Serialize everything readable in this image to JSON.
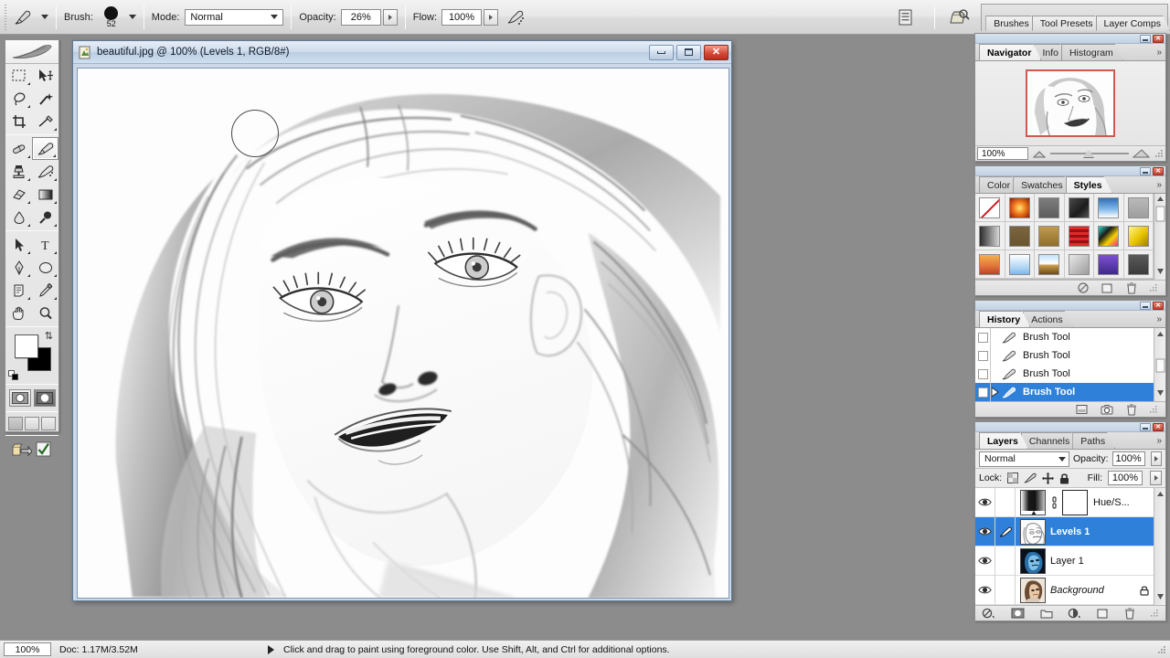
{
  "app": {
    "name": "Adobe Photoshop"
  },
  "options_bar": {
    "tool_icon": "brush-tool-icon",
    "brush_label": "Brush:",
    "brush_size": "52",
    "mode_label": "Mode:",
    "mode_value": "Normal",
    "opacity_label": "Opacity:",
    "opacity_value": "26%",
    "flow_label": "Flow:",
    "flow_value": "100%",
    "airbrush_icon": "airbrush-icon",
    "toggle_palettes_icon": "toggle-palettes-icon",
    "file_browser_icon": "file-browser-icon",
    "palette_well_tabs": [
      "Brushes",
      "Tool Presets",
      "Layer Comps"
    ]
  },
  "toolbox": {
    "header_icon": "photoshop-feather-logo",
    "tools": [
      {
        "name": "marquee-tool",
        "glyph": "marquee",
        "selected": false,
        "corner": true
      },
      {
        "name": "move-tool",
        "glyph": "move",
        "selected": false,
        "corner": false
      },
      {
        "name": "lasso-tool",
        "glyph": "lasso",
        "selected": false,
        "corner": true
      },
      {
        "name": "magic-wand-tool",
        "glyph": "wand",
        "selected": false,
        "corner": false
      },
      {
        "name": "crop-tool",
        "glyph": "crop",
        "selected": false,
        "corner": false
      },
      {
        "name": "slice-tool",
        "glyph": "slice",
        "selected": false,
        "corner": true
      },
      {
        "name": "healing-brush-tool",
        "glyph": "heal",
        "selected": false,
        "corner": true
      },
      {
        "name": "brush-tool",
        "glyph": "brush",
        "selected": true,
        "corner": true
      },
      {
        "name": "clone-stamp-tool",
        "glyph": "stamp",
        "selected": false,
        "corner": true
      },
      {
        "name": "history-brush-tool",
        "glyph": "historybrush",
        "selected": false,
        "corner": true
      },
      {
        "name": "eraser-tool",
        "glyph": "eraser",
        "selected": false,
        "corner": true
      },
      {
        "name": "gradient-tool",
        "glyph": "gradient",
        "selected": false,
        "corner": true
      },
      {
        "name": "blur-tool",
        "glyph": "blur",
        "selected": false,
        "corner": true
      },
      {
        "name": "dodge-tool",
        "glyph": "dodge",
        "selected": false,
        "corner": true
      },
      {
        "name": "path-selection-tool",
        "glyph": "pathsel",
        "selected": false,
        "corner": true
      },
      {
        "name": "type-tool",
        "glyph": "type",
        "selected": false,
        "corner": true
      },
      {
        "name": "pen-tool",
        "glyph": "pen",
        "selected": false,
        "corner": true
      },
      {
        "name": "shape-tool",
        "glyph": "shape",
        "selected": false,
        "corner": true
      },
      {
        "name": "notes-tool",
        "glyph": "notes",
        "selected": false,
        "corner": true
      },
      {
        "name": "eyedropper-tool",
        "glyph": "eyedropper",
        "selected": false,
        "corner": true
      },
      {
        "name": "hand-tool",
        "glyph": "hand",
        "selected": false,
        "corner": false
      },
      {
        "name": "zoom-tool",
        "glyph": "zoom",
        "selected": false,
        "corner": false
      }
    ],
    "foreground_color": "#ffffff",
    "background_color": "#000000",
    "quickmask_modes": [
      "standard-mask-mode",
      "quick-mask-mode"
    ],
    "screen_modes": [
      "standard-screen-mode",
      "full-screen-with-menubar",
      "full-screen-mode"
    ],
    "jump_to_imageready_icon": "jump-to-imageready-icon",
    "check_icon": "check-icon"
  },
  "document": {
    "title": "beautiful.jpg @ 100% (Levels 1, RGB/8#)",
    "icon": "document-icon",
    "window_buttons": [
      "minimize",
      "maximize",
      "close"
    ],
    "canvas_description": "pencil-sketch portrait of a woman looking upward",
    "brush_cursor_size_px": 52
  },
  "navigator_panel": {
    "tabs": [
      "Navigator",
      "Info",
      "Histogram"
    ],
    "active_tab": "Navigator",
    "more_icon": "panel-menu-icon",
    "zoom_value": "100%",
    "zoom_out_icon": "zoom-out-icon",
    "zoom_in_icon": "zoom-in-icon",
    "view_box_color": "#cc5a4e"
  },
  "styles_panel": {
    "tabs": [
      "Color",
      "Swatches",
      "Styles"
    ],
    "active_tab": "Styles",
    "more_icon": "panel-menu-icon",
    "swatches": [
      {
        "name": "none-style",
        "type": "none"
      },
      {
        "name": "style-red-glow",
        "css": "radial-gradient(circle at 50% 50%, #ffe47a 0%, #ef7a1b 45%, #8c1a05 100%)"
      },
      {
        "name": "style-gray-button",
        "css": "linear-gradient(to bottom,#7d7d7d,#5d5d5d)"
      },
      {
        "name": "style-dark-texture",
        "css": "linear-gradient(135deg,#4a4a4a,#1c1c1c 60%,#555)"
      },
      {
        "name": "style-blue-sky",
        "css": "linear-gradient(to bottom,#2f6fb5 0%,#7fb6e8 55%,#ffffff 100%)"
      },
      {
        "name": "style-flat-gray",
        "css": "linear-gradient(to bottom,#b9b9b9,#9e9e9e)"
      },
      {
        "name": "style-black-fade",
        "css": "linear-gradient(to right,#2b2b2b,#d6d6d6)"
      },
      {
        "name": "style-brown-matte",
        "css": "linear-gradient(to bottom,#7b6540,#6a552f)"
      },
      {
        "name": "style-tan-bevel",
        "css": "linear-gradient(to bottom,#c09a4e,#8e6f2f)"
      },
      {
        "name": "style-red-stripes",
        "css": "repeating-linear-gradient(to bottom,#e02a2a 0 3px,#9a0f12 3px 6px)"
      },
      {
        "name": "style-graffiti",
        "css": "linear-gradient(135deg,#2bd9c6 0%,#1a1a1a 35%,#f4d400 65%,#e0348a 100%)"
      },
      {
        "name": "style-yellow-bevel",
        "css": "linear-gradient(135deg,#fff38a,#e8c400 55%,#9a8000)"
      },
      {
        "name": "style-orange-sunset",
        "css": "linear-gradient(to bottom,#f3b24c,#e2713a 60%,#b8442a)"
      },
      {
        "name": "style-light-blue",
        "css": "linear-gradient(to bottom,#ffffff,#a9d2f3 70%,#7fb6e8)"
      },
      {
        "name": "style-beach",
        "css": "linear-gradient(to bottom,#bfe2f7 0%,#ffffff 45%,#c79a4a 55%,#6b4a1e 100%)"
      },
      {
        "name": "style-photo-frame",
        "css": "linear-gradient(135deg,#e8e8e8,#9c9c9c)"
      },
      {
        "name": "style-purple-blocks",
        "css": "linear-gradient(to bottom,#7d4fd4,#3e2b86)"
      },
      {
        "name": "style-charcoal",
        "css": "linear-gradient(to bottom,#5a5a5a,#3b3b3b)"
      }
    ],
    "footer_icons": [
      "clear-style-icon",
      "new-style-icon",
      "delete-style-icon"
    ]
  },
  "history_panel": {
    "tabs": [
      "History",
      "Actions"
    ],
    "active_tab": "History",
    "more_icon": "panel-menu-icon",
    "items": [
      {
        "label": "Brush Tool",
        "icon": "brush-state-icon",
        "selected": false
      },
      {
        "label": "Brush Tool",
        "icon": "brush-state-icon",
        "selected": false
      },
      {
        "label": "Brush Tool",
        "icon": "brush-state-icon",
        "selected": false
      },
      {
        "label": "Brush Tool",
        "icon": "brush-state-icon",
        "selected": true
      }
    ],
    "footer_icons": [
      "new-document-from-state-icon",
      "new-snapshot-icon",
      "delete-state-icon"
    ]
  },
  "layers_panel": {
    "tabs": [
      "Layers",
      "Channels",
      "Paths"
    ],
    "active_tab": "Layers",
    "more_icon": "panel-menu-icon",
    "blend_mode": "Normal",
    "opacity_label": "Opacity:",
    "opacity_value": "100%",
    "lock_label": "Lock:",
    "lock_icons": [
      "lock-transparent-pixels-icon",
      "lock-image-pixels-icon",
      "lock-position-icon",
      "lock-all-icon"
    ],
    "fill_label": "Fill:",
    "fill_value": "100%",
    "layers": [
      {
        "name": "Hue/S...",
        "selected": false,
        "visible": true,
        "has_mask": true,
        "italic": false,
        "locked": false,
        "thumb": "adjustment-gradient-thumb"
      },
      {
        "name": "Levels 1",
        "selected": true,
        "visible": true,
        "has_mask": false,
        "italic": false,
        "locked": false,
        "thumb": "sketch-portrait-thumb"
      },
      {
        "name": "Layer 1",
        "selected": false,
        "visible": true,
        "has_mask": false,
        "italic": false,
        "locked": false,
        "thumb": "blue-inverted-portrait-thumb"
      },
      {
        "name": "Background",
        "selected": false,
        "visible": true,
        "has_mask": false,
        "italic": true,
        "locked": true,
        "thumb": "color-portrait-thumb"
      }
    ],
    "footer_icons": [
      "layer-style-icon",
      "add-layer-mask-icon",
      "new-group-icon",
      "new-adjustment-layer-icon",
      "new-layer-icon",
      "delete-layer-icon"
    ]
  },
  "status_bar": {
    "zoom": "100%",
    "doc_info": "Doc: 1.17M/3.52M",
    "hint": "Click and drag to paint using foreground color.  Use Shift, Alt, and Ctrl for additional options."
  },
  "colors": {
    "selection_blue": "#2e80d8",
    "title_blue": "#cfdcec",
    "panel_gray": "#e8e8e8",
    "app_background": "#8c8c8c",
    "close_red": "#c2402e"
  }
}
